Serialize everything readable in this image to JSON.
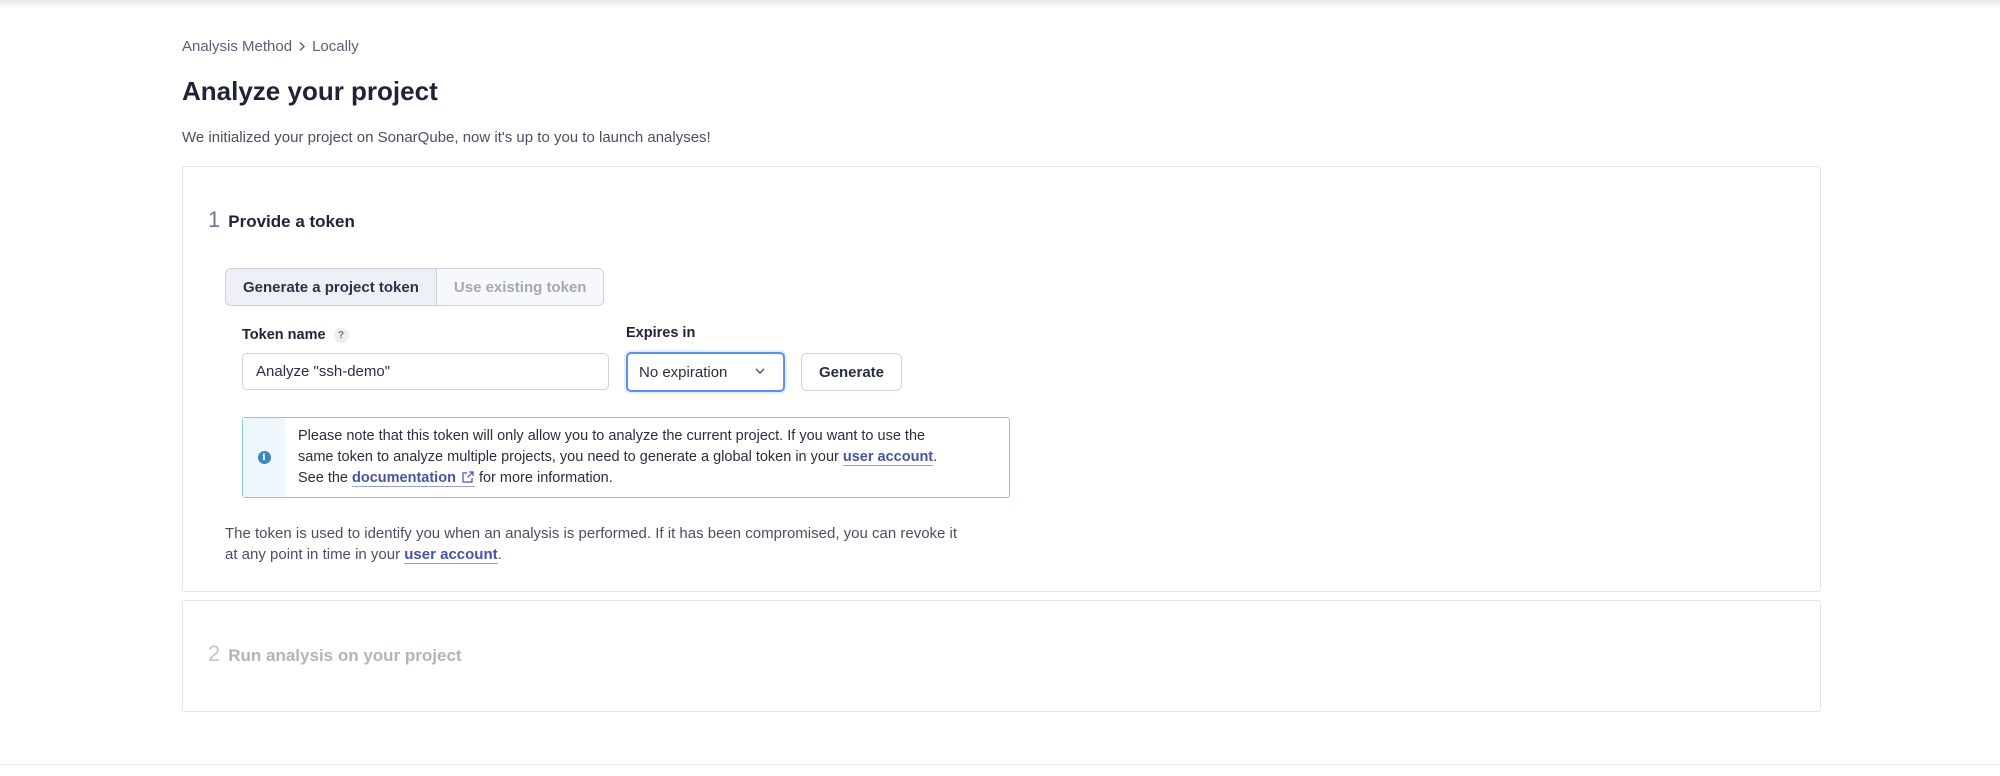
{
  "breadcrumb": {
    "items": [
      "Analysis Method",
      "Locally"
    ],
    "separator_icon": "chevron-right-icon"
  },
  "page": {
    "title": "Analyze your project",
    "description": "We initialized your project on SonarQube, now it's up to you to launch analyses!"
  },
  "step1": {
    "number": "1",
    "title": "Provide a token",
    "toggle": {
      "options": [
        "Generate a project token",
        "Use existing token"
      ],
      "selected": "Generate a project token"
    },
    "token_name": {
      "label": "Token name",
      "help_icon": "question-mark-icon",
      "help_glyph": "?",
      "value": "Analyze \"ssh-demo\""
    },
    "expires": {
      "label": "Expires in",
      "selected": "No expiration",
      "icon": "chevron-down-icon"
    },
    "generate_label": "Generate",
    "alert": {
      "icon": "info-icon",
      "icon_glyph": "i",
      "line1": "Please note that this token will only allow you to analyze the current project. If you want to use the",
      "line2_pre": "same token to analyze multiple projects, you need to generate a global token in your ",
      "line2_link": "user account",
      "line2_post": ".",
      "line3_pre": "See the ",
      "line3_link": "documentation",
      "line3_icon": "external-link-icon",
      "line3_post": " for more information."
    },
    "footer": {
      "line1": "The token is used to identify you when an analysis is performed. If it has been compromised, you can revoke it",
      "line2_pre": "at any point in time in your ",
      "line2_link": "user account",
      "line2_post": "."
    }
  },
  "step2": {
    "number": "2",
    "title": "Run analysis on your project"
  },
  "colors": {
    "accent": "#5d8ff0",
    "link": "#4953a3",
    "info": "#3c88b8",
    "alert_border": "#8cc7dd"
  }
}
